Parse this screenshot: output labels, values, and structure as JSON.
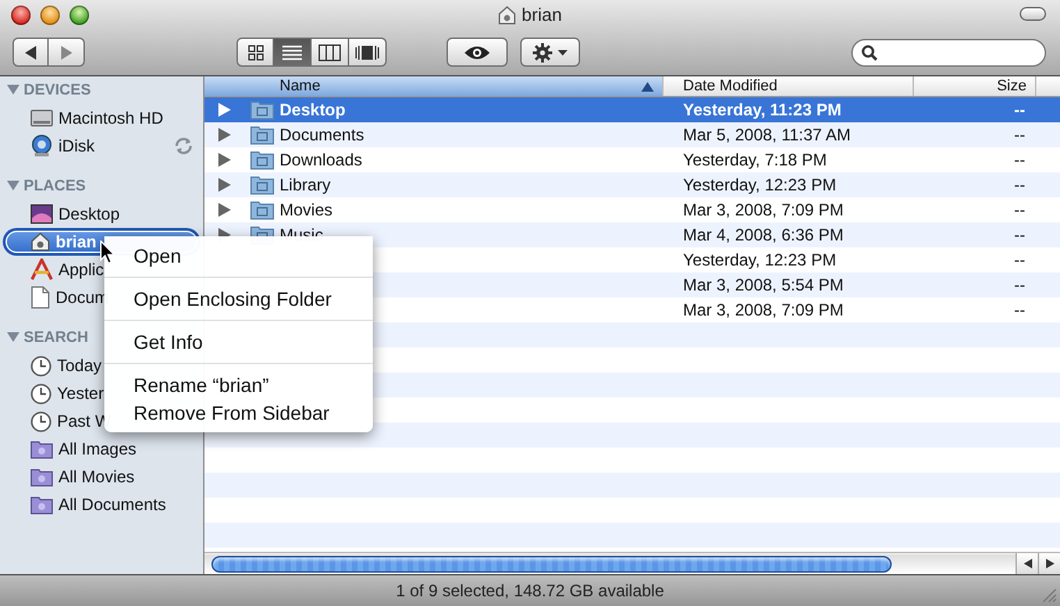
{
  "window": {
    "title": "brian"
  },
  "toolbar": {
    "view_modes": [
      {
        "kind": "icon",
        "selected": false
      },
      {
        "kind": "list",
        "selected": true
      },
      {
        "kind": "column",
        "selected": false
      },
      {
        "kind": "cover-flow",
        "selected": false
      }
    ]
  },
  "sidebar": {
    "sections": [
      {
        "title": "DEVICES",
        "expanded": true,
        "items": [
          {
            "label": "Macintosh HD",
            "kind": "drive",
            "selected": false,
            "syncing": false
          },
          {
            "label": "iDisk",
            "kind": "idisk",
            "selected": false,
            "syncing": true
          }
        ]
      },
      {
        "title": "PLACES",
        "expanded": true,
        "items": [
          {
            "label": "Desktop",
            "kind": "desktop",
            "selected": false,
            "syncing": false
          },
          {
            "label": "brian",
            "kind": "home",
            "selected": true,
            "syncing": false
          },
          {
            "label": "Applic",
            "kind": "apps",
            "selected": false,
            "syncing": false
          },
          {
            "label": "Docum",
            "kind": "document",
            "selected": false,
            "syncing": false
          }
        ]
      },
      {
        "title": "SEARCH",
        "expanded": true,
        "items": [
          {
            "label": "Today",
            "kind": "clock",
            "selected": false,
            "syncing": false
          },
          {
            "label": "Yester",
            "kind": "clock",
            "selected": false,
            "syncing": false
          },
          {
            "label": "Past W",
            "kind": "clock",
            "selected": false,
            "syncing": false
          },
          {
            "label": "All Images",
            "kind": "smart",
            "selected": false,
            "syncing": false
          },
          {
            "label": "All Movies",
            "kind": "smart",
            "selected": false,
            "syncing": false
          },
          {
            "label": "All Documents",
            "kind": "smart",
            "selected": false,
            "syncing": false
          }
        ]
      }
    ]
  },
  "table": {
    "columns": [
      {
        "label": "Name",
        "sorted": true
      },
      {
        "label": "Date Modified",
        "sorted": false
      },
      {
        "label": "Size",
        "sorted": false
      }
    ],
    "rows": [
      {
        "name": "Desktop",
        "date": "Yesterday, 11:23 PM",
        "size": "--",
        "selected": true
      },
      {
        "name": "Documents",
        "date": "Mar 5, 2008, 11:37 AM",
        "size": "--",
        "selected": false
      },
      {
        "name": "Downloads",
        "date": "Yesterday, 7:18 PM",
        "size": "--",
        "selected": false
      },
      {
        "name": "Library",
        "date": "Yesterday, 12:23 PM",
        "size": "--",
        "selected": false
      },
      {
        "name": "Movies",
        "date": "Mar 3, 2008, 7:09 PM",
        "size": "--",
        "selected": false
      },
      {
        "name": "Music",
        "date": "Mar 4, 2008, 6:36 PM",
        "size": "--",
        "selected": false
      },
      {
        "date": "Yesterday, 12:23 PM",
        "size": "--",
        "selected": false
      },
      {
        "date": "Mar 3, 2008, 5:54 PM",
        "size": "--",
        "selected": false
      },
      {
        "date": "Mar 3, 2008, 7:09 PM",
        "size": "--",
        "selected": false
      }
    ]
  },
  "context_menu": {
    "groups": [
      [
        {
          "label": "Open"
        }
      ],
      [
        {
          "label": "Open Enclosing Folder"
        }
      ],
      [
        {
          "label": "Get Info"
        }
      ],
      [
        {
          "label": "Rename “brian”"
        },
        {
          "label": "Remove From Sidebar"
        }
      ]
    ]
  },
  "status_bar": {
    "text": "1 of 9 selected, 148.72 GB available"
  }
}
